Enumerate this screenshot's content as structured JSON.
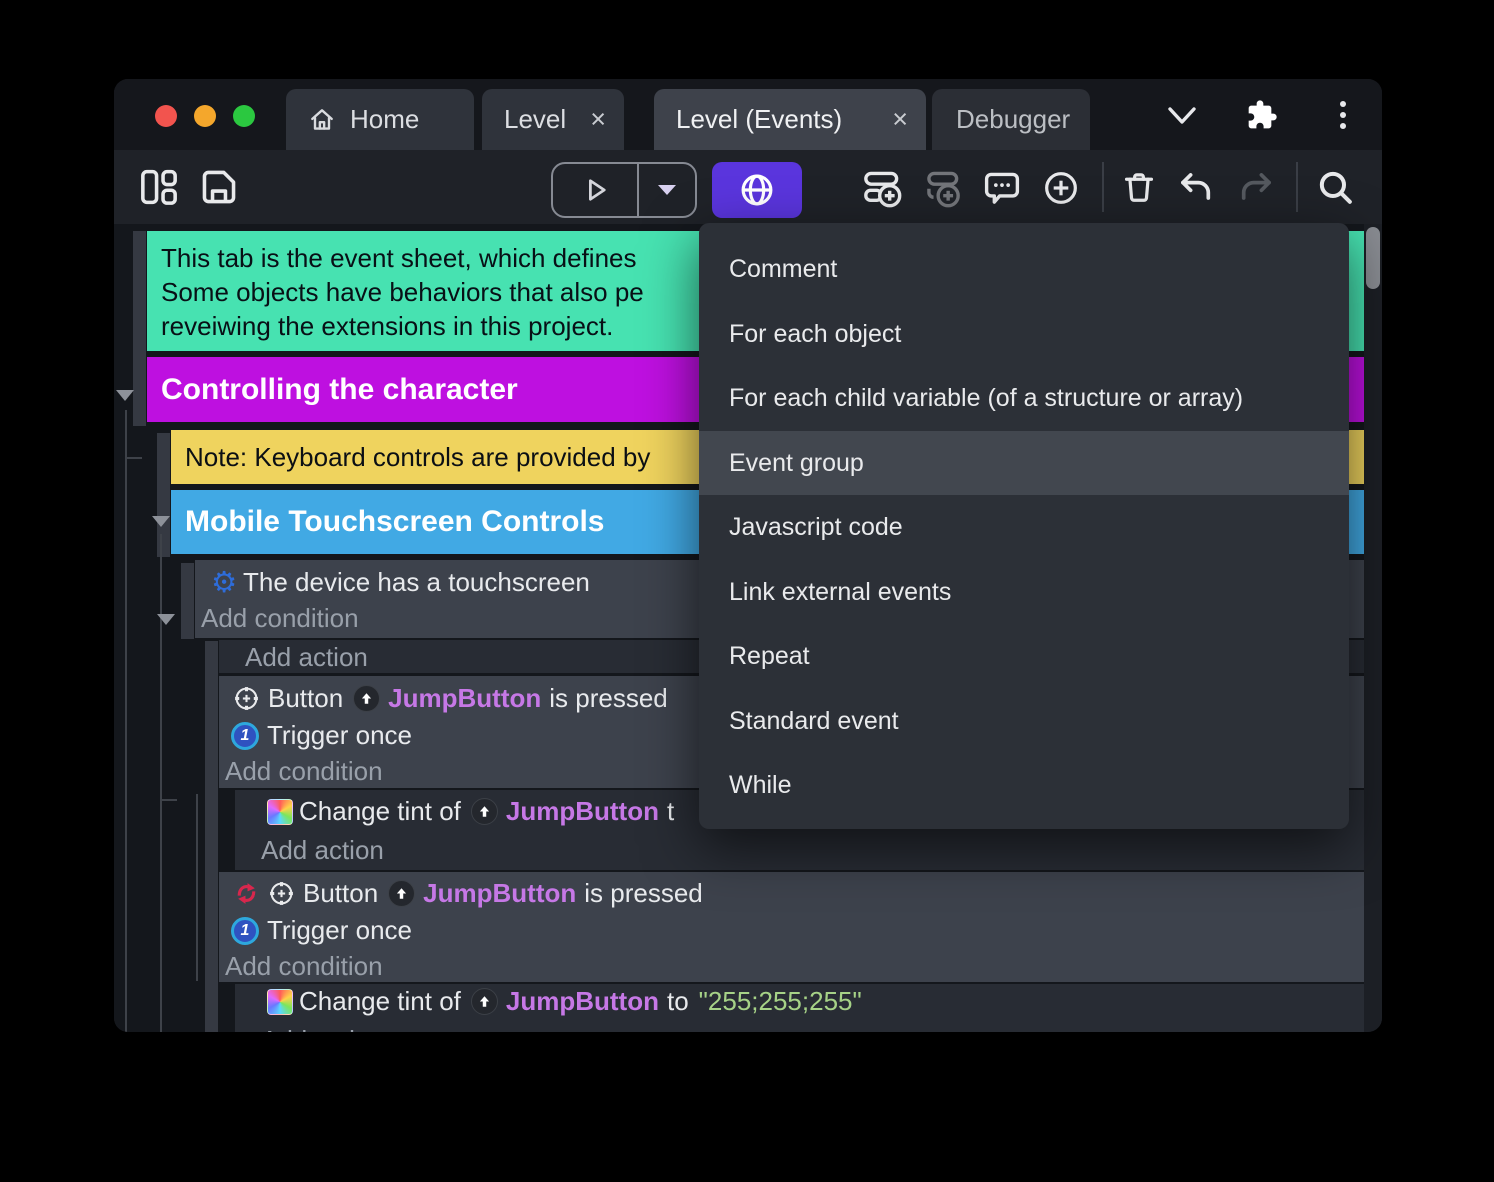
{
  "titlebar": {
    "tabs": {
      "home": "Home",
      "level": "Level",
      "level_events": "Level (Events)",
      "debugger": "Debugger"
    },
    "close_glyph": "×"
  },
  "icons": {
    "touch_gear": "⚙"
  },
  "menu": {
    "items": [
      "Comment",
      "For each object",
      "For each child variable (of a structure or array)",
      "Event group",
      "Javascript code",
      "Link external events",
      "Repeat",
      "Standard event",
      "While"
    ],
    "highlighted_item": "Event group"
  },
  "sheet": {
    "comment_lines": [
      "This tab is the event sheet, which defines",
      "Some objects have behaviors that also pe",
      "reveiwing the extensions in this project."
    ],
    "group_character": "Controlling the character",
    "note": "Note: Keyboard controls are provided by",
    "group_touch": "Mobile Touchscreen Controls",
    "touch_condition": "The device has a touchscreen",
    "add_condition": "Add condition",
    "add_action": "Add action",
    "button_word": "Button",
    "object_name": "JumpButton",
    "pressed_suffix": "is pressed",
    "trigger_once": "Trigger once",
    "trigger_once_badge": "1",
    "tint_prefix": "Change tint of",
    "tint_partial_suffix": "t",
    "tint_to": "to",
    "tint_value": "\"255;255;255\""
  },
  "colors": {
    "accent_purple": "#5a35dd",
    "comment_green": "#47e2b1",
    "group_magenta": "#be10e0",
    "note_yellow": "#efd35e",
    "group_blue": "#41a9e4",
    "object_violet": "#c678e6",
    "string_green": "#a6d287",
    "traffic_red": "#f2544e",
    "traffic_yellow": "#f4a72c",
    "traffic_green": "#2bc840"
  }
}
